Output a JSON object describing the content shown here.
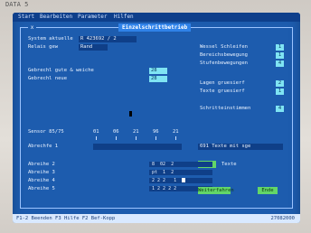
{
  "bezel_label": "DATA 5",
  "menu": [
    "Start",
    "Bearbeiten",
    "Parameter",
    "Hilfen"
  ],
  "dialog": {
    "title": "Einzelschrittbetrieb",
    "close": "x"
  },
  "left_top": {
    "rows": [
      {
        "label": "System   aktuelle",
        "value": "R 423692 / 2"
      },
      {
        "label": "Relais   gew",
        "value": "Rand"
      }
    ]
  },
  "left_mid": {
    "rows": [
      {
        "label": "Gebrechl  gute & weiche",
        "value": "28"
      },
      {
        "label": "Gebrechl  neue",
        "value": "28"
      }
    ]
  },
  "right_panel": {
    "rows": [
      {
        "label": "Wessel Schleifen",
        "value": "1"
      },
      {
        "label": "Bereichsbewegung",
        "value": "1"
      },
      {
        "label": "Stufenbewegungen",
        "value": "4"
      },
      {
        "label": "Lagen gruesierf",
        "value": "2"
      },
      {
        "label": "Texte gruesierf",
        "value": "1"
      },
      {
        "label": "Schritteinstimmen",
        "value": "4"
      }
    ]
  },
  "ruler": {
    "label": "Sensor 85/75",
    "ticks": [
      "01",
      "06",
      "21",
      "96",
      "21"
    ]
  },
  "abrechn_row": {
    "label": "Abrechfe    1",
    "value": "691 Texte mit sge"
  },
  "button_text": "Text",
  "button_text_label": "Texte",
  "grid": {
    "rows": [
      {
        "label": "Abreihe    2",
        "value": " 8  02  2 "
      },
      {
        "label": "Abreihe    3",
        "value": " pt  1  2 "
      },
      {
        "label": "Abreihe    4",
        "value": " 2 2 2   1"
      },
      {
        "label": "Abreihe    5",
        "value": " 1 2 2 2 2"
      }
    ]
  },
  "bottom_buttons": {
    "continue": "Weiterfahren",
    "exit": "Ende"
  },
  "status": {
    "left": "F1-2 Beenden   F3 Hilfe   F2 Bef-Kopp",
    "right": "27082000"
  }
}
